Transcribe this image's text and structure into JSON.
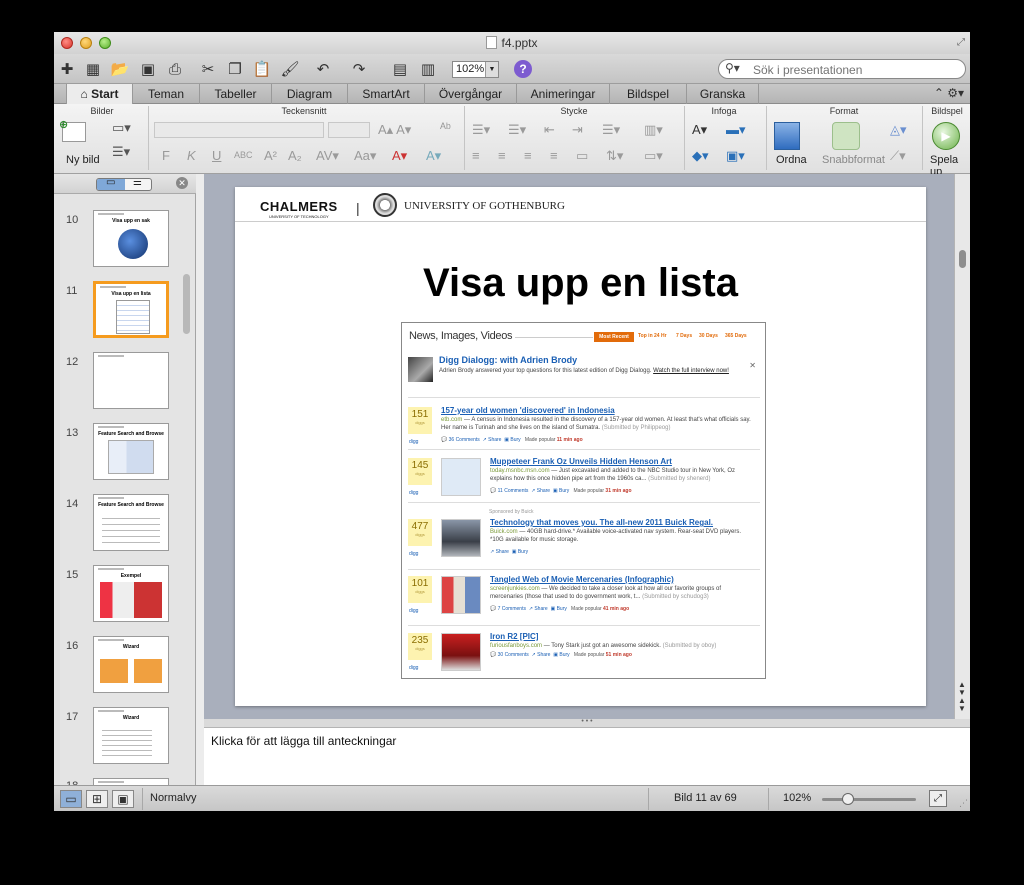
{
  "window": {
    "title": "f4.pptx"
  },
  "toolbar": {
    "zoom_value": "102%",
    "search_placeholder": "Sök i presentationen"
  },
  "tabs": [
    "Start",
    "Teman",
    "Tabeller",
    "Diagram",
    "SmartArt",
    "Övergångar",
    "Animeringar",
    "Bildspel",
    "Granska"
  ],
  "ribbon": {
    "groups": [
      "Bilder",
      "Teckensnitt",
      "Stycke",
      "Infoga",
      "Format",
      "Bildspel"
    ],
    "new_slide_label": "Ny bild",
    "arrange_label": "Ordna",
    "quick_styles_label": "Snabbformat",
    "play_label": "Spela up"
  },
  "slides_panel": {
    "numbers": [
      "10",
      "11",
      "12",
      "13",
      "14",
      "15",
      "16",
      "17",
      "18"
    ],
    "titles": [
      "Visa upp en sak",
      "Visa upp en lista",
      "",
      "Feature Search and Browse",
      "Feature Search and Browse",
      "Exempel",
      "Wizard",
      "Wizard",
      ""
    ],
    "selected_index": 1
  },
  "slide": {
    "logo_left": "CHALMERS",
    "logo_left_sub": "UNIVERSITY OF TECHNOLOGY",
    "logo_right": "UNIVERSITY OF GOTHENBURG",
    "title": "Visa upp en lista",
    "screenshot": {
      "heading": "News, Images, Videos",
      "filters": [
        "Most Recent",
        "Top in 24 Hr",
        "7 Days",
        "30 Days",
        "365 Days"
      ],
      "feature_title": "Digg Dialogg: with Adrien Brody",
      "feature_desc": "Adrien Brody answered your top questions for this latest edition of Digg Dialogg.",
      "feature_link": "Watch the full interview now!",
      "sponsored": "Sponsored by Buick",
      "stories": [
        {
          "count": "151",
          "title": "157-year old women 'discovered' in Indonesia",
          "source": "etb.com",
          "desc": "— A census in Indonesia resulted in the discovery of a 157-year old women. At least that's what officials say. Her name is Turinah and she lives on the island of Sumatra.",
          "submitted": "(Submitted by Philippeog)",
          "comments": "36 Comments",
          "popular": "Made popular",
          "time": "11 min ago"
        },
        {
          "count": "145",
          "title": "Muppeteer Frank Oz Unveils Hidden Henson Art",
          "source": "today.msnbc.msn.com",
          "desc": "— Just excavated and added to the NBC Studio tour in New York, Oz explains how this once hidden pipe art from the 1960s ca...",
          "submitted": "(Submitted by shenerd)",
          "comments": "11 Comments",
          "popular": "Made popular",
          "time": "31 min ago"
        },
        {
          "count": "477",
          "title": "Technology that moves you. The all-new 2011 Buick Regal.",
          "source": "Buick.com",
          "desc": "— 40GB hard-drive.* Available voice-activated nav system. Rear-seat DVD players. *10G available for music storage.",
          "submitted": "",
          "comments": "",
          "popular": "",
          "time": ""
        },
        {
          "count": "101",
          "title": "Tangled Web of Movie Mercenaries (Infographic)",
          "source": "screenjunkies.com",
          "desc": "— We decided to take a closer look at how all our favorite groups of mercenaries (those that used to do government work, t...",
          "submitted": "(Submitted by schudog3)",
          "comments": "7 Comments",
          "popular": "Made popular",
          "time": "41 min ago"
        },
        {
          "count": "235",
          "title": "Iron R2 [PIC]",
          "source": "furiousfanboys.com",
          "desc": "— Tony Stark just got an awesome sidekick.",
          "submitted": "(Submitted by oboy)",
          "comments": "30 Comments",
          "popular": "Made popular",
          "time": "51 min ago"
        }
      ],
      "diggs_label": "diggs",
      "digg_label": "digg",
      "share_label": "Share",
      "bury_label": "Bury"
    }
  },
  "notes": {
    "placeholder": "Klicka för att lägga till anteckningar"
  },
  "status": {
    "view_name": "Normalvy",
    "slide_counter": "Bild 11 av 69",
    "zoom": "102%"
  }
}
